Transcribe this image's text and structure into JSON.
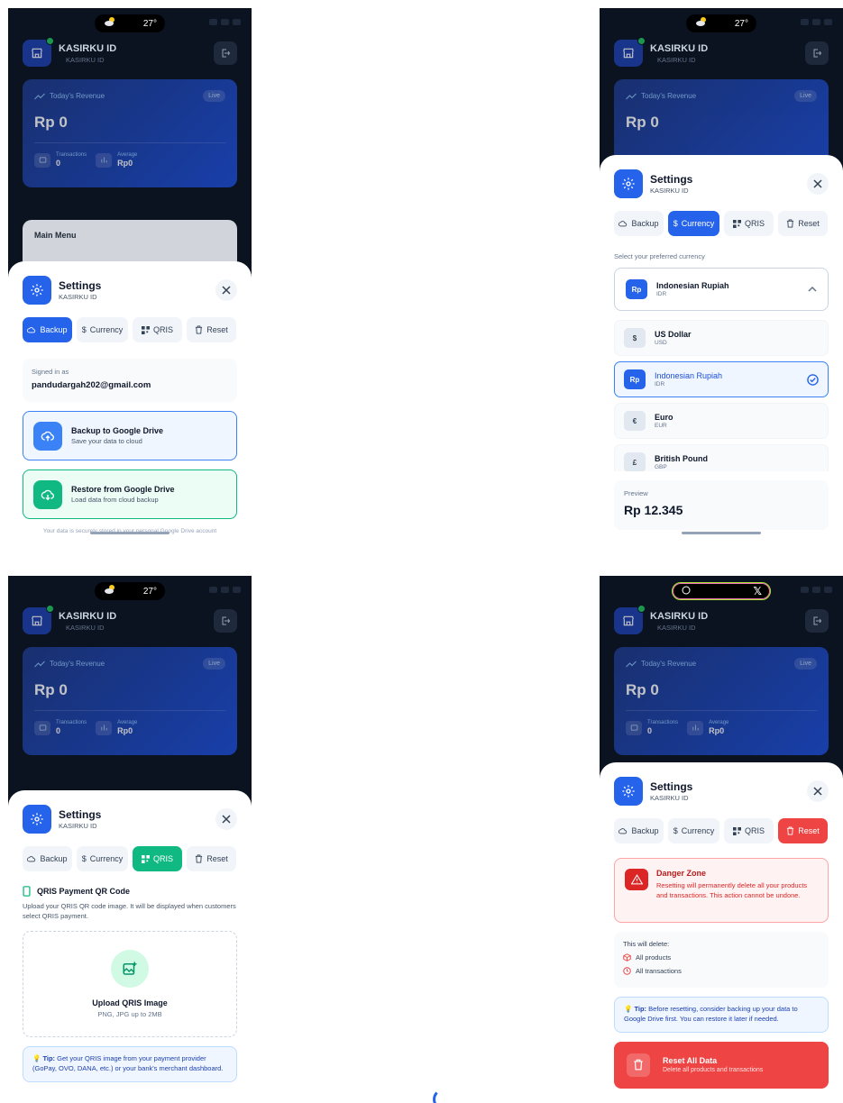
{
  "status": {
    "temperature": "27°"
  },
  "app": {
    "store_name": "KASIRKU ID",
    "store_sub": "KASIRKU ID",
    "revenue_label": "Today's Revenue",
    "live": "Live",
    "revenue_amount": "Rp 0",
    "transactions_label": "Transactions",
    "transactions_value": "0",
    "average_label": "Average",
    "average_value": "Rp0",
    "main_menu": "Main Menu"
  },
  "settings": {
    "title": "Settings",
    "subtitle": "KASIRKU ID",
    "tabs": [
      "Backup",
      "Currency",
      "QRIS",
      "Reset"
    ]
  },
  "backup": {
    "signed_label": "Signed in as",
    "email": "pandudargah202@gmail.com",
    "backup_title": "Backup to Google Drive",
    "backup_sub": "Save your data to cloud",
    "restore_title": "Restore from Google Drive",
    "restore_sub": "Load data from cloud backup",
    "footnote": "Your data is securely stored in your personal Google Drive account"
  },
  "currency": {
    "label": "Select your preferred currency",
    "selected": {
      "badge": "Rp",
      "name": "Indonesian Rupiah",
      "code": "IDR"
    },
    "options": [
      {
        "badge": "$",
        "name": "US Dollar",
        "code": "USD"
      },
      {
        "badge": "Rp",
        "name": "Indonesian Rupiah",
        "code": "IDR"
      },
      {
        "badge": "€",
        "name": "Euro",
        "code": "EUR"
      },
      {
        "badge": "£",
        "name": "British Pound",
        "code": "GBP"
      }
    ],
    "preview_label": "Preview",
    "preview_value": "Rp 12.345"
  },
  "qris": {
    "title": "QRIS Payment QR Code",
    "desc": "Upload your QRIS QR code image. It will be displayed when customers select QRIS payment.",
    "upload_title": "Upload QRIS Image",
    "upload_sub": "PNG, JPG up to 2MB",
    "tip_label": "Tip:",
    "tip_text": "Get your QRIS image from your payment provider (GoPay, OVO, DANA, etc.) or your bank's merchant dashboard."
  },
  "reset": {
    "danger_title": "Danger Zone",
    "danger_text": "Resetting will permanently delete all your products and transactions. This action cannot be undone.",
    "will_delete": "This will delete:",
    "item1": "All products",
    "item2": "All transactions",
    "tip_label": "Tip:",
    "tip_text": "Before resetting, consider backing up your data to Google Drive first. You can restore it later if needed.",
    "btn_title": "Reset All Data",
    "btn_sub": "Delete all products and transactions"
  }
}
